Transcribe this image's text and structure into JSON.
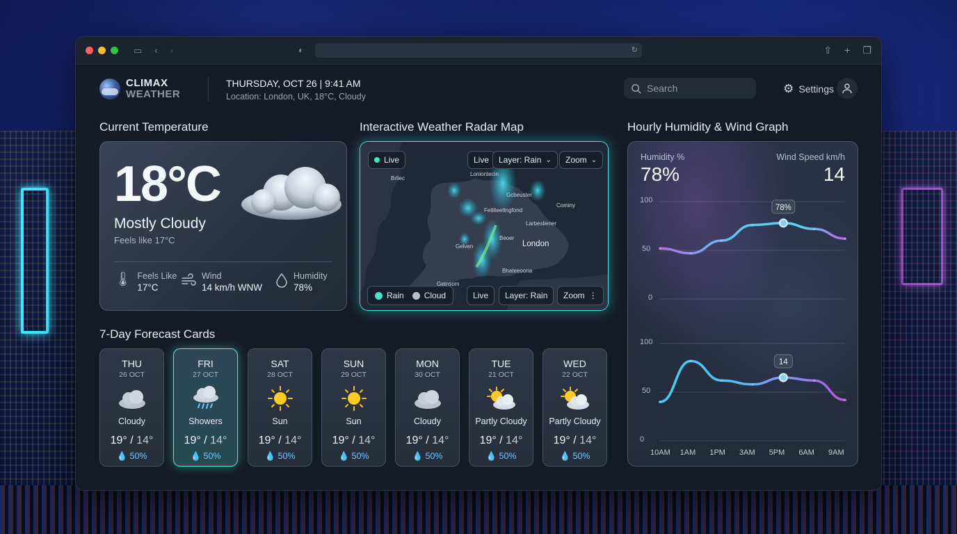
{
  "app": {
    "brand_line1": "CLIMAX",
    "brand_line2": "WEATHER",
    "date": "THURSDAY, OCT 26  |  9:41 AM",
    "location": "Location: London, UK, 18°C, Cloudy",
    "search_placeholder": "Search",
    "settings_label": "Settings"
  },
  "current": {
    "section_title": "Current Temperature",
    "temp": "18°C",
    "condition": "Mostly Cloudy",
    "feels_like": "Feels like 17°C",
    "stats": [
      {
        "label": "Feels Like",
        "value": "17°C",
        "icon": "thermometer-icon"
      },
      {
        "label": "Wind",
        "value": "14 km/h WNW",
        "icon": "wind-icon"
      },
      {
        "label": "Humidity",
        "value": "78%",
        "icon": "droplet-icon"
      }
    ]
  },
  "radar": {
    "section_title": "Interactive Weather Radar Map",
    "live_badge": "Live",
    "top_live": "Live",
    "layer_top": "Layer: Rain",
    "zoom_top": "Zoom",
    "legend_rain": "Rain",
    "legend_cloud": "Cloud",
    "bottom_live": "Live",
    "layer_bottom": "Layer: Rain",
    "zoom_bottom": "Zoom",
    "places": {
      "p1": "Loniontecin",
      "p2": "Brliec",
      "p3": "Gcbeuster",
      "p4": "Fetliteettngfond",
      "p5": "Cominy",
      "p6": "Larbesliener",
      "p7": "Gelven",
      "p8": "Beoer",
      "p9": "London",
      "p10": "Bhateeoona",
      "p11": "Getnsom"
    },
    "colors": {
      "accent": "#4fd8e8",
      "rain": "#3ee6d0",
      "cloud": "#b8c0cc"
    }
  },
  "forecast": {
    "section_title": "7-Day Forecast Cards",
    "days": [
      {
        "day": "THU",
        "date": "26 OCT",
        "cond": "Cloudy",
        "hi": "19°",
        "lo": "14°",
        "hum": "50%",
        "icon": "cloud"
      },
      {
        "day": "FRI",
        "date": "27 OCT",
        "cond": "Showers",
        "hi": "19°",
        "lo": "14°",
        "hum": "50%",
        "icon": "showers"
      },
      {
        "day": "SAT",
        "date": "28 OCT",
        "cond": "Sun",
        "hi": "19°",
        "lo": "14°",
        "hum": "50%",
        "icon": "sun"
      },
      {
        "day": "SUN",
        "date": "29 OCT",
        "cond": "Sun",
        "hi": "19°",
        "lo": "14°",
        "hum": "50%",
        "icon": "sun"
      },
      {
        "day": "MON",
        "date": "30 OCT",
        "cond": "Cloudy",
        "hi": "19°",
        "lo": "14°",
        "hum": "50%",
        "icon": "cloud"
      },
      {
        "day": "TUE",
        "date": "21 OCT",
        "cond": "Partly Cloudy",
        "hi": "19°",
        "lo": "14°",
        "hum": "50%",
        "icon": "partly"
      },
      {
        "day": "WED",
        "date": "22 OCT",
        "cond": "Partly Cloudy",
        "hi": "19°",
        "lo": "14°",
        "hum": "50%",
        "icon": "partly"
      }
    ]
  },
  "graph": {
    "section_title": "Hourly Humidity & Wind Graph",
    "humidity_label": "Humidity %",
    "humidity_value": "78%",
    "wind_label": "Wind Speed km/h",
    "wind_value": "14",
    "humidity_marker": "78%",
    "wind_marker": "14",
    "y_top": [
      "100",
      "50",
      "0"
    ],
    "y_bottom": [
      "100",
      "50",
      "0"
    ],
    "x_labels": [
      "10AM",
      "1AM",
      "1PM",
      "3AM",
      "5PM",
      "6AM",
      "9AM"
    ]
  },
  "chart_data": [
    {
      "type": "line",
      "title": "",
      "ylabel": "Humidity %",
      "ylim": [
        0,
        100
      ],
      "x": [
        "10AM",
        "1AM",
        "1PM",
        "3AM",
        "5PM",
        "6AM",
        "9AM"
      ],
      "series": [
        {
          "name": "Humidity %",
          "values": [
            52,
            47,
            60,
            76,
            78,
            72,
            62
          ]
        }
      ],
      "annotations": [
        "78%"
      ]
    },
    {
      "type": "line",
      "title": "",
      "ylabel": "Wind Speed km/h",
      "ylim": [
        0,
        100
      ],
      "x": [
        "10AM",
        "1AM",
        "1PM",
        "3AM",
        "5PM",
        "6AM",
        "9AM"
      ],
      "series": [
        {
          "name": "Wind Speed km/h",
          "values": [
            40,
            82,
            62,
            58,
            65,
            62,
            42
          ]
        }
      ],
      "annotations": [
        "14"
      ]
    }
  ]
}
